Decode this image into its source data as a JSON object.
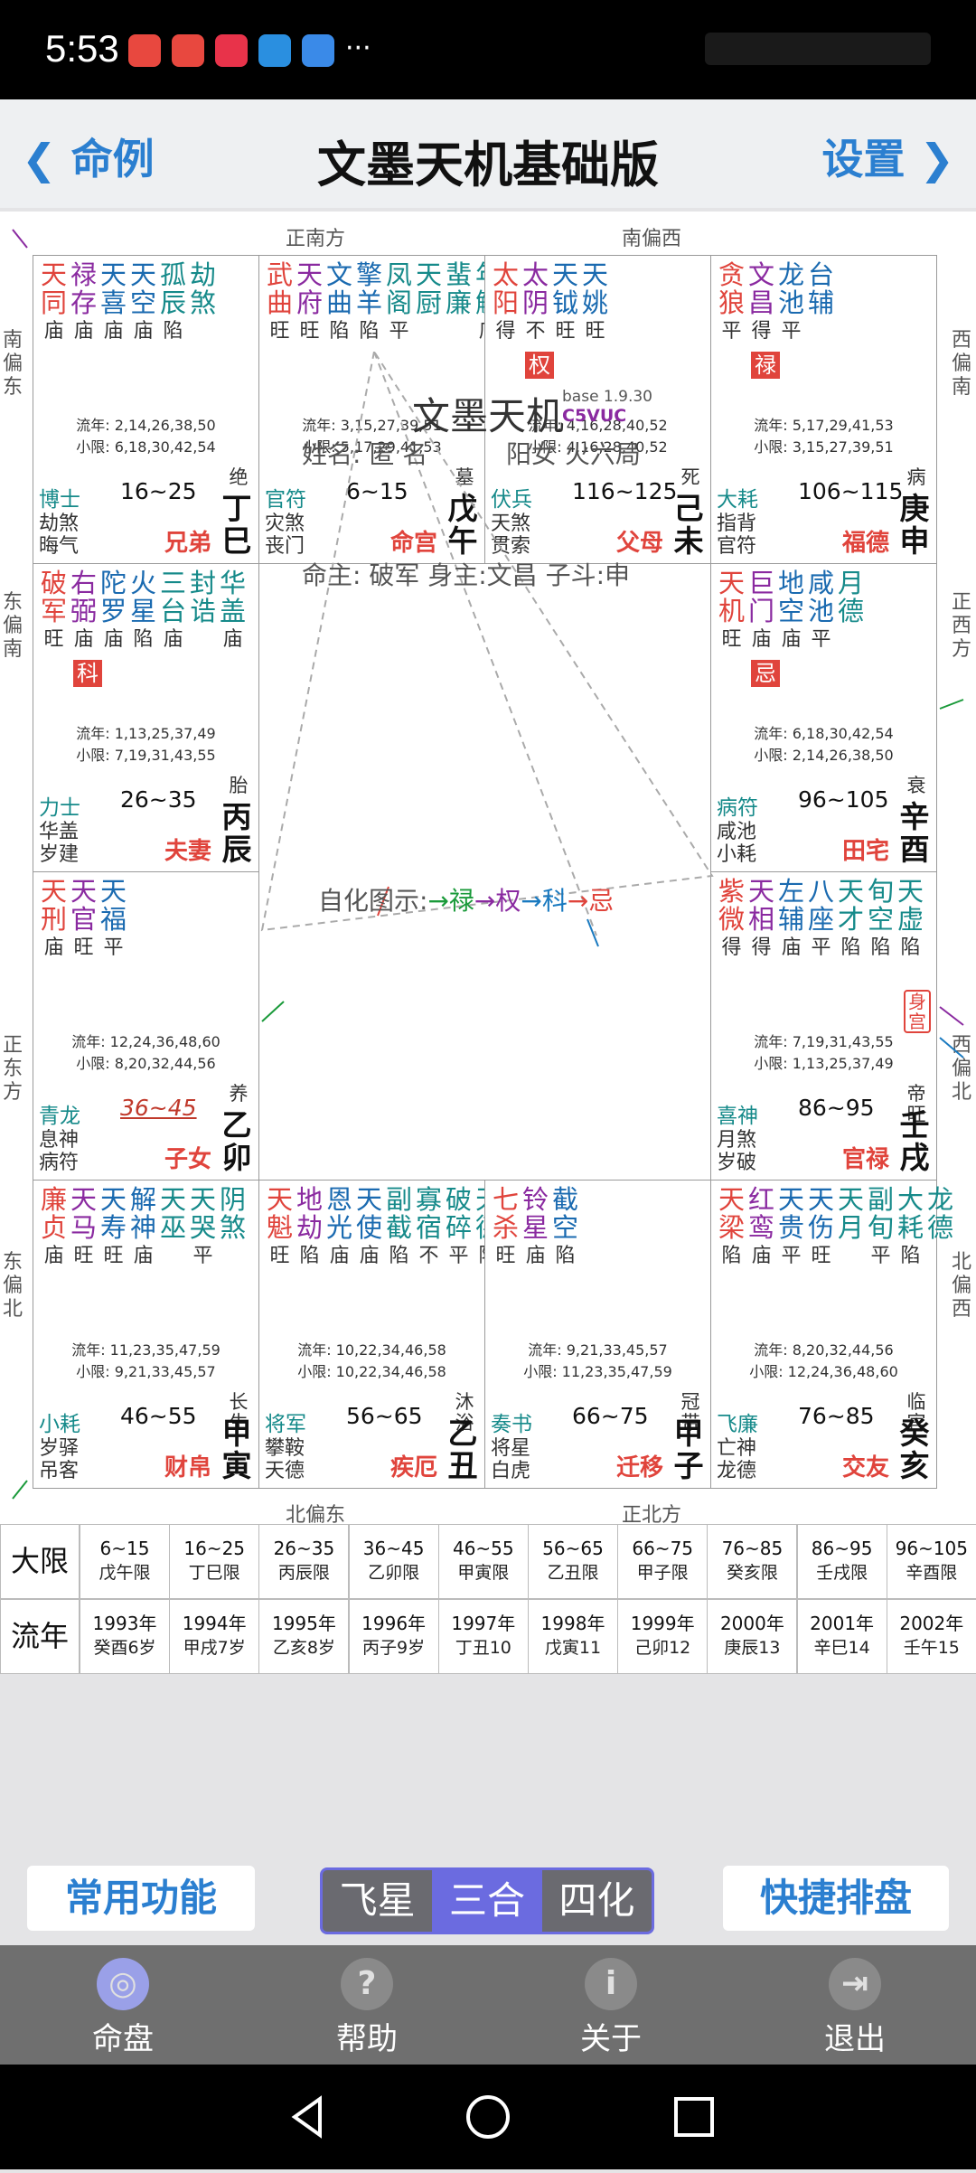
{
  "status": {
    "time": "5:53",
    "more": "···"
  },
  "header": {
    "back": "命例",
    "title": "文墨天机基础版",
    "settings": "设置"
  },
  "directions": {
    "top_left": "正南方",
    "top_right": "南偏西",
    "bottom_left": "北偏东",
    "bottom_right": "正北方",
    "left": [
      "南偏东",
      "东偏南",
      "正东方",
      "东偏北"
    ],
    "right": [
      "西偏南",
      "正西方",
      "西偏北",
      "北偏西"
    ]
  },
  "palaces": [
    {
      "stars": [
        [
          "天同",
          "庙"
        ],
        [
          "禄存",
          "庙"
        ],
        [
          "天喜",
          "庙"
        ],
        [
          "天空",
          "庙"
        ],
        [
          "孤辰",
          "陷"
        ],
        [
          "劫煞",
          ""
        ]
      ],
      "liunian": "流年: 2,14,26,38,50",
      "xiaoxian": "小限: 6,18,30,42,54",
      "range": "16~25",
      "left": [
        "博士",
        "劫煞",
        "晦气"
      ],
      "zhangsheng": "绝",
      "name": "兄弟",
      "ganzhi": "丁巳"
    },
    {
      "stars": [
        [
          "武曲",
          "旺"
        ],
        [
          "天府",
          "旺"
        ],
        [
          "文曲",
          "陷"
        ],
        [
          "擎羊",
          "陷"
        ],
        [
          "凤阁",
          "平"
        ],
        [
          "天厨",
          ""
        ],
        [
          "蜚廉",
          ""
        ],
        [
          "年解",
          "庙"
        ]
      ],
      "liunian": "流年: 3,15,27,39,51",
      "xiaoxian": "小限: 5,17,29,41,53",
      "range": "6~15",
      "left": [
        "官符",
        "灾煞",
        "丧门"
      ],
      "zhangsheng": "墓",
      "name": "命宫",
      "ganzhi": "戊午"
    },
    {
      "stars": [
        [
          "太阳",
          "得"
        ],
        [
          "太阴",
          "不"
        ],
        [
          "天钺",
          "旺"
        ],
        [
          "天姚",
          "旺"
        ]
      ],
      "mark": "权",
      "liunian": "流年: 4,16,28,40,52",
      "xiaoxian": "小限: 4,16,28,40,52",
      "range": "116~125",
      "left": [
        "伏兵",
        "天煞",
        "贯索"
      ],
      "zhangsheng": "死",
      "name": "父母",
      "ganzhi": "己未"
    },
    {
      "stars": [
        [
          "贪狼",
          "平"
        ],
        [
          "文昌",
          "得"
        ],
        [
          "龙池",
          "平"
        ],
        [
          "台辅",
          ""
        ]
      ],
      "mark": "禄",
      "liunian": "流年: 5,17,29,41,53",
      "xiaoxian": "小限: 3,15,27,39,51",
      "range": "106~115",
      "left": [
        "大耗",
        "指背",
        "官符"
      ],
      "zhangsheng": "病",
      "name": "福德",
      "ganzhi": "庚申"
    },
    {
      "stars": [
        [
          "破军",
          "旺"
        ],
        [
          "右弼",
          "庙"
        ],
        [
          "陀罗",
          "庙"
        ],
        [
          "火星",
          "陷"
        ],
        [
          "三台",
          "庙"
        ],
        [
          "封诰",
          ""
        ],
        [
          "华盖",
          "庙"
        ]
      ],
      "mark": "科",
      "liunian": "流年: 1,13,25,37,49",
      "xiaoxian": "小限: 7,19,31,43,55",
      "range": "26~35",
      "left": [
        "力士",
        "华盖",
        "岁建"
      ],
      "zhangsheng": "胎",
      "name": "夫妻",
      "ganzhi": "丙辰"
    },
    {
      "stars": [
        [
          "天机",
          "旺"
        ],
        [
          "巨门",
          "庙"
        ],
        [
          "地空",
          "庙"
        ],
        [
          "咸池",
          "平"
        ],
        [
          "月德",
          ""
        ]
      ],
      "mark": "忌",
      "liunian": "流年: 6,18,30,42,54",
      "xiaoxian": "小限: 2,14,26,38,50",
      "range": "96~105",
      "left": [
        "病符",
        "咸池",
        "小耗"
      ],
      "zhangsheng": "衰",
      "name": "田宅",
      "ganzhi": "辛酉"
    },
    {
      "stars": [
        [
          "天刑",
          "庙"
        ],
        [
          "天官",
          "旺"
        ],
        [
          "天福",
          "平"
        ]
      ],
      "liunian": "流年: 12,24,36,48,60",
      "xiaoxian": "小限: 8,20,32,44,56",
      "range": "36~45",
      "left": [
        "青龙",
        "息神",
        "病符"
      ],
      "zhangsheng": "养",
      "name": "子女",
      "ganzhi": "乙卯"
    },
    {
      "stars": [
        [
          "紫微",
          "得"
        ],
        [
          "天相",
          "得"
        ],
        [
          "左辅",
          "庙"
        ],
        [
          "八座",
          "平"
        ],
        [
          "天才",
          "陷"
        ],
        [
          "旬空",
          "陷"
        ],
        [
          "天虚",
          "陷"
        ]
      ],
      "shen": "身宫",
      "liunian": "流年: 7,19,31,43,55",
      "xiaoxian": "小限: 1,13,25,37,49",
      "range": "86~95",
      "left": [
        "喜神",
        "月煞",
        "岁破"
      ],
      "zhangsheng": "帝旺",
      "name": "官禄",
      "ganzhi": "壬戌"
    },
    {
      "stars": [
        [
          "廉贞",
          "庙"
        ],
        [
          "天马",
          "旺"
        ],
        [
          "天寿",
          "旺"
        ],
        [
          "解神",
          "庙"
        ],
        [
          "天巫",
          ""
        ],
        [
          "天哭",
          "平"
        ],
        [
          "阴煞",
          ""
        ]
      ],
      "liunian": "流年: 11,23,35,47,59",
      "xiaoxian": "小限: 9,21,33,45,57",
      "range": "46~55",
      "left": [
        "小耗",
        "岁驿",
        "吊客"
      ],
      "zhangsheng": "长生",
      "name": "财帛",
      "ganzhi": "甲寅"
    },
    {
      "stars": [
        [
          "天魁",
          "旺"
        ],
        [
          "地劫",
          "陷"
        ],
        [
          "恩光",
          "庙"
        ],
        [
          "天使",
          "庙"
        ],
        [
          "副截",
          "陷"
        ],
        [
          "寡宿",
          "不"
        ],
        [
          "破碎",
          "平"
        ],
        [
          "天德",
          "陷"
        ]
      ],
      "liunian": "流年: 10,22,34,46,58",
      "xiaoxian": "小限: 10,22,34,46,58",
      "range": "56~65",
      "left": [
        "将军",
        "攀鞍",
        "天德"
      ],
      "zhangsheng": "沐浴",
      "name": "疾厄",
      "ganzhi": "乙丑"
    },
    {
      "stars": [
        [
          "七杀",
          "旺"
        ],
        [
          "铃星",
          "庙"
        ],
        [
          "截空",
          "陷"
        ]
      ],
      "liunian": "流年: 9,21,33,45,57",
      "xiaoxian": "小限: 11,23,35,47,59",
      "range": "66~75",
      "left": [
        "奏书",
        "将星",
        "白虎"
      ],
      "zhangsheng": "冠带",
      "name": "迁移",
      "ganzhi": "甲子"
    },
    {
      "stars": [
        [
          "天梁",
          "陷"
        ],
        [
          "红鸾",
          "庙"
        ],
        [
          "天贵",
          "平"
        ],
        [
          "天伤",
          "旺"
        ],
        [
          "天月",
          ""
        ],
        [
          "副旬",
          "平"
        ],
        [
          "大耗",
          "陷"
        ],
        [
          "龙德",
          ""
        ]
      ],
      "liunian": "流年: 8,20,32,44,56",
      "xiaoxian": "小限: 12,24,36,48,60",
      "range": "76~85",
      "left": [
        "飞廉",
        "亡神",
        "龙德"
      ],
      "zhangsheng": "临官",
      "name": "交友",
      "ganzhi": "癸亥"
    }
  ],
  "center": {
    "title": "文墨天机",
    "version": "base 1.9.30",
    "code": "C5VUC",
    "name_label": "姓名: 匿 名",
    "gender": "阳女 火六局",
    "ming": "命主: 破军 身主:文昌 子斗:申",
    "zihua_label": "自化图示:",
    "zihua": [
      [
        "→禄",
        "#1a9a3a"
      ],
      [
        "→权",
        "#8a2aa0"
      ],
      [
        "→科",
        "#1a7ac0"
      ],
      [
        "→忌",
        "#e0443c"
      ]
    ]
  },
  "daxian": {
    "label": "大限",
    "items": [
      [
        "6~15",
        "戊午限"
      ],
      [
        "16~25",
        "丁巳限"
      ],
      [
        "26~35",
        "丙辰限"
      ],
      [
        "36~45",
        "乙卯限"
      ],
      [
        "46~55",
        "甲寅限"
      ],
      [
        "56~65",
        "乙丑限"
      ],
      [
        "66~75",
        "甲子限"
      ],
      [
        "76~85",
        "癸亥限"
      ],
      [
        "86~95",
        "壬戌限"
      ],
      [
        "96~105",
        "辛酉限"
      ]
    ]
  },
  "liunian": {
    "label": "流年",
    "items": [
      [
        "1993年",
        "癸酉6岁"
      ],
      [
        "1994年",
        "甲戌7岁"
      ],
      [
        "1995年",
        "乙亥8岁"
      ],
      [
        "1996年",
        "丙子9岁"
      ],
      [
        "1997年",
        "丁丑10"
      ],
      [
        "1998年",
        "戊寅11"
      ],
      [
        "1999年",
        "己卯12"
      ],
      [
        "2000年",
        "庚辰13"
      ],
      [
        "2001年",
        "辛巳14"
      ],
      [
        "2002年",
        "壬午15"
      ]
    ]
  },
  "buttons": {
    "common": "常用功能",
    "quick": "快捷排盘",
    "segments": [
      "飞星",
      "三合",
      "四化"
    ],
    "selected_segment": "三合"
  },
  "tabs": [
    {
      "label": "命盘",
      "icon": "chart-icon"
    },
    {
      "label": "帮助",
      "icon": "help-icon"
    },
    {
      "label": "关于",
      "icon": "info-icon"
    },
    {
      "label": "退出",
      "icon": "exit-icon"
    }
  ],
  "colors": {
    "accent": "#2b7fd0",
    "red": "#e0443c",
    "teal": "#168a8a",
    "purple": "#6b6be0"
  }
}
